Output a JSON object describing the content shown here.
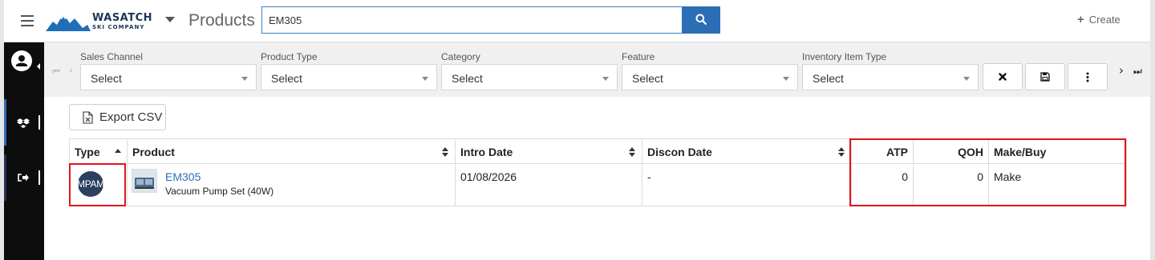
{
  "header": {
    "brand_line1": "WASATCH",
    "brand_line2": "SKI COMPANY",
    "page_title": "Products",
    "search_value": "EM305",
    "create_label": "Create"
  },
  "filters": [
    {
      "label": "Sales Channel",
      "value": "Select"
    },
    {
      "label": "Product Type",
      "value": "Select"
    },
    {
      "label": "Category",
      "value": "Select"
    },
    {
      "label": "Feature",
      "value": "Select"
    },
    {
      "label": "Inventory Item Type",
      "value": "Select"
    }
  ],
  "toolbar": {
    "export_label": "Export CSV"
  },
  "table": {
    "columns": [
      "Type",
      "Product",
      "Intro Date",
      "Discon Date",
      "ATP",
      "QOH",
      "Make/Buy"
    ],
    "rows": [
      {
        "type_badge": "MPAM",
        "product_id": "EM305",
        "product_desc": "Vacuum Pump Set (40W)",
        "intro_date": "01/08/2026",
        "discon_date": "-",
        "atp": "0",
        "qoh": "0",
        "make_buy": "Make"
      }
    ]
  },
  "colors": {
    "accent": "#2c6eb5",
    "sidebar": "#0d0d0d",
    "highlight": "#e0151b",
    "badge": "#2b3f5e"
  },
  "icons": [
    "hamburger-icon",
    "search-icon",
    "plus-icon",
    "user-icon",
    "dropbox-icon",
    "sign-out-icon",
    "first-page-icon",
    "prev-page-icon",
    "close-icon",
    "save-icon",
    "more-vertical-icon",
    "next-page-icon",
    "last-page-icon",
    "csv-file-icon",
    "sort-icon",
    "sort-asc-icon"
  ]
}
